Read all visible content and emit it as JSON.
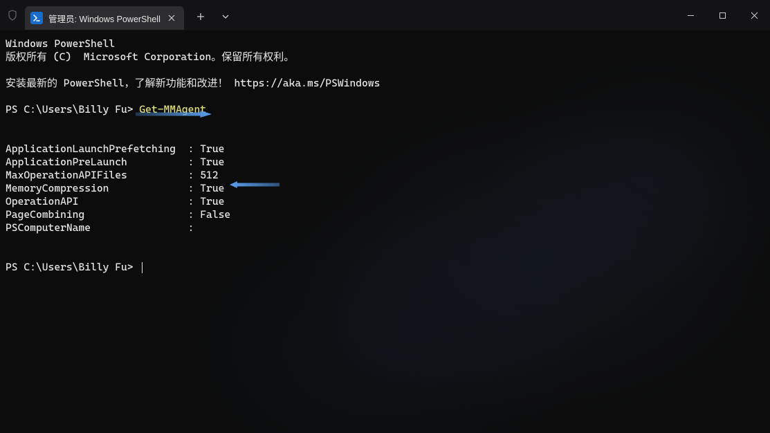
{
  "titlebar": {
    "tab_title": "管理员: Windows PowerShell",
    "shield_tooltip": "Shield"
  },
  "terminal": {
    "line1": "Windows PowerShell",
    "line2": "版权所有 (C)  Microsoft Corporation。保留所有权利。",
    "line3": "",
    "line4": "安装最新的 PowerShell，了解新功能和改进！ https://aka.ms/PSWindows",
    "line5": "",
    "prompt1_prefix": "PS C:\\Users\\Billy Fu> ",
    "prompt1_cmd": "Get-MMAgent",
    "output": {
      "keys": [
        "ApplicationLaunchPrefetching",
        "ApplicationPreLaunch",
        "MaxOperationAPIFiles",
        "MemoryCompression",
        "OperationAPI",
        "PageCombining",
        "PSComputerName"
      ],
      "values": [
        "True",
        "True",
        "512",
        "True",
        "True",
        "False",
        ""
      ]
    },
    "prompt2": "PS C:\\Users\\Billy Fu> "
  }
}
